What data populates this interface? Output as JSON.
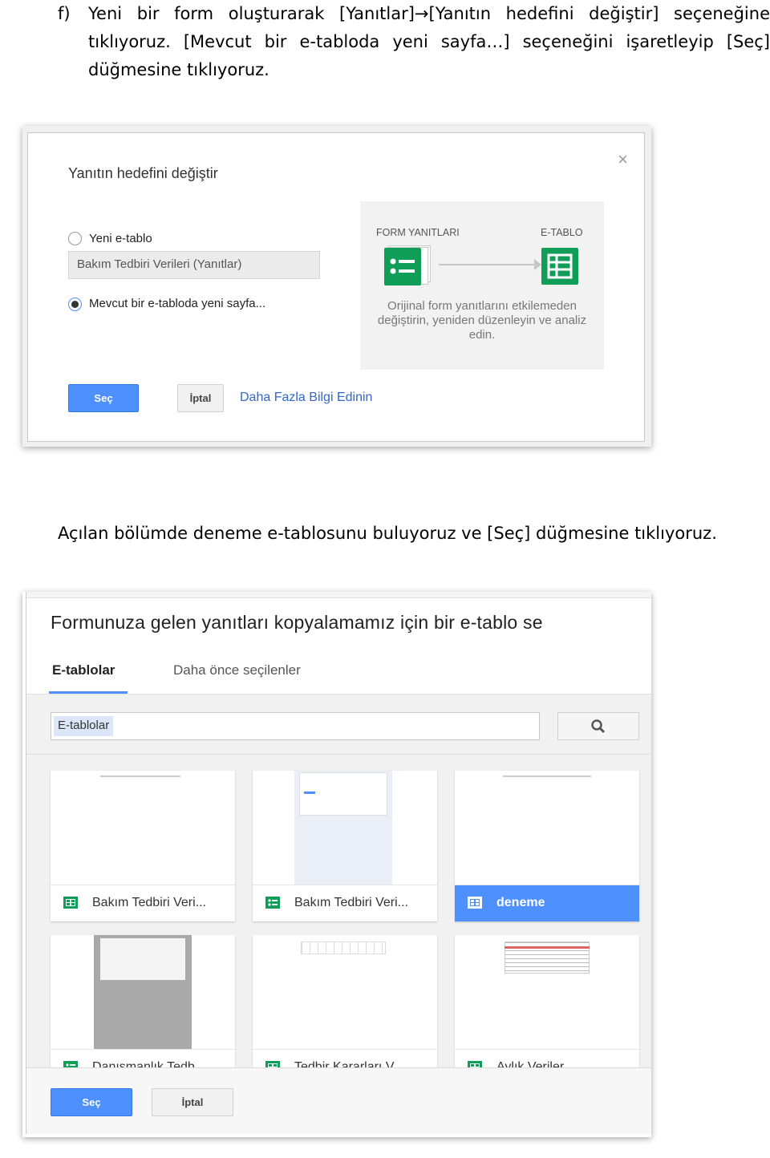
{
  "doc": {
    "step_f": {
      "marker": "f)",
      "text": "Yeni bir form oluşturarak [Yanıtlar]→[Yanıtın hedefini değiştir] seçeneğine tıklıyoruz. [Mevcut bir e-tabloda yeni sayfa…] seçeneğini işaretleyip [Seç] düğmesine tıklıyoruz."
    },
    "step2": "Açılan bölümde deneme e-tablosunu buluyoruz ve [Seç] düğmesine tıklıyoruz."
  },
  "dialog1": {
    "title": "Yanıtın hedefini değiştir",
    "close": "×",
    "option_new": "Yeni e-tablo",
    "new_name_value": "Bakım Tedbiri Verileri (Yanıtlar)",
    "option_existing": "Mevcut bir e-tabloda yeni sayfa...",
    "selected_option": "existing",
    "info": {
      "label_left": "FORM YANITLARI",
      "label_right": "E-TABLO",
      "description": "Orijinal form yanıtlarını etkilemeden değiştirin, yeniden düzenleyin ve analiz edin."
    },
    "btn_select": "Seç",
    "btn_cancel": "İptal",
    "link_more": "Daha Fazla Bilgi Edinin"
  },
  "dialog2": {
    "title": "Formunuza gelen yanıtları kopyalamamız için bir e-tablo se",
    "tabs": [
      "E-tablolar",
      "Daha önce seçilenler"
    ],
    "active_tab": 0,
    "search_chip": "E-tablolar",
    "files": [
      {
        "name": "Bakım Tedbiri Veri...",
        "icon": "sheets-icon",
        "selected": false
      },
      {
        "name": "Bakım Tedbiri Veri...",
        "icon": "forms-icon",
        "selected": false
      },
      {
        "name": "deneme",
        "icon": "sheets-icon",
        "selected": true
      },
      {
        "name": "Danışmanlık Tedb...",
        "icon": "forms-icon",
        "selected": false
      },
      {
        "name": "Tedbir Kararları V...",
        "icon": "sheets-icon",
        "selected": false
      },
      {
        "name": "Aylık Veriler",
        "icon": "sheets-icon",
        "selected": false
      }
    ],
    "btn_select": "Seç",
    "btn_cancel": "İptal"
  },
  "colors": {
    "accent_blue": "#4d90fe",
    "sheets_green": "#0f9d58",
    "forms_green": "#0f9d58",
    "link_blue": "#3366cc"
  }
}
